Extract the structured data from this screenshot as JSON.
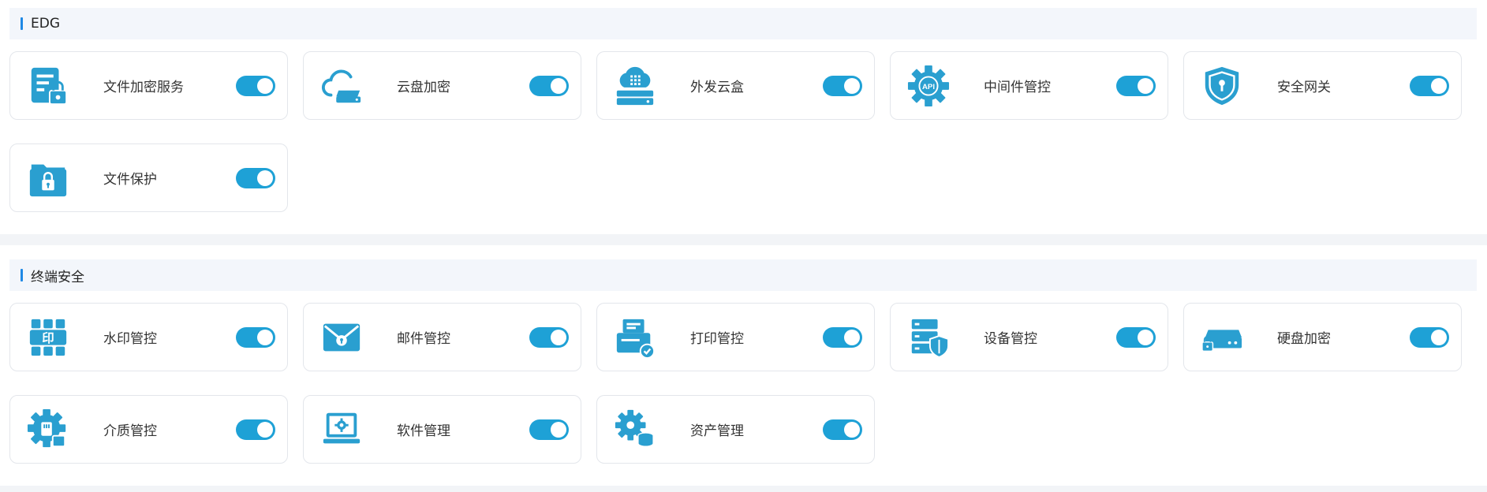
{
  "sections": [
    {
      "title": "EDG",
      "items": [
        {
          "label": "文件加密服务",
          "icon": "file-lock-icon",
          "enabled": true
        },
        {
          "label": "云盘加密",
          "icon": "cloud-drive-icon",
          "enabled": true
        },
        {
          "label": "外发云盒",
          "icon": "cloud-box-icon",
          "enabled": true
        },
        {
          "label": "中间件管控",
          "icon": "api-gear-icon",
          "enabled": true
        },
        {
          "label": "安全网关",
          "icon": "shield-lock-icon",
          "enabled": true
        },
        {
          "label": "文件保护",
          "icon": "folder-lock-icon",
          "enabled": true
        }
      ]
    },
    {
      "title": "终端安全",
      "items": [
        {
          "label": "水印管控",
          "icon": "watermark-icon",
          "enabled": true
        },
        {
          "label": "邮件管控",
          "icon": "mail-icon",
          "enabled": true
        },
        {
          "label": "打印管控",
          "icon": "printer-check-icon",
          "enabled": true
        },
        {
          "label": "设备管控",
          "icon": "server-shield-icon",
          "enabled": true
        },
        {
          "label": "硬盘加密",
          "icon": "disk-lock-icon",
          "enabled": true
        },
        {
          "label": "介质管控",
          "icon": "media-gear-icon",
          "enabled": true
        },
        {
          "label": "软件管理",
          "icon": "laptop-gear-icon",
          "enabled": true
        },
        {
          "label": "资产管理",
          "icon": "gear-database-icon",
          "enabled": true
        }
      ]
    }
  ],
  "colors": {
    "accent": "#1ea1d6",
    "icon": "#2a9fd0",
    "header_bar": "#1e88e5"
  }
}
